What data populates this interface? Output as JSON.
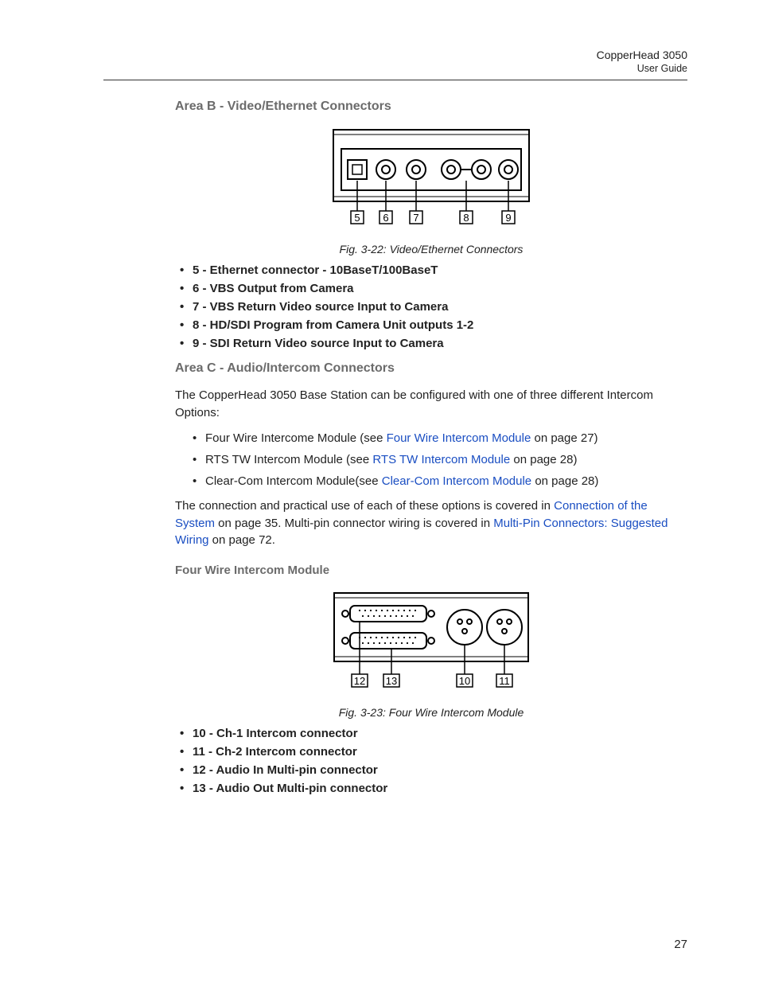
{
  "header": {
    "product": "CopperHead 3050",
    "doc": "User Guide"
  },
  "sectionB": {
    "heading": "Area B - Video/Ethernet Connectors",
    "fig_caption": "Fig. 3-22: Video/Ethernet Connectors",
    "labels": {
      "l5": "5",
      "l6": "6",
      "l7": "7",
      "l8": "8",
      "l9": "9"
    },
    "items": [
      "5 - Ethernet connector - 10BaseT/100BaseT",
      "6 - VBS Output from Camera",
      "7 - VBS Return Video source Input to Camera",
      "8 - HD/SDI Program from Camera Unit outputs 1-2",
      "9 - SDI Return Video source Input to Camera"
    ]
  },
  "sectionC": {
    "heading": "Area C - Audio/Intercom Connectors",
    "intro": "The CopperHead 3050 Base Station can be configured with one of three different Intercom Options:",
    "opts": [
      {
        "pre": "Four Wire Intercome Module (see ",
        "link": "Four Wire Intercom Module",
        "post": " on page 27)"
      },
      {
        "pre": "RTS TW Intercom Module (see ",
        "link": "RTS TW Intercom Module",
        "post": " on page 28)"
      },
      {
        "pre": "Clear-Com Intercom Module(see ",
        "link": "Clear-Com Intercom Module",
        "post": " on page 28)"
      }
    ],
    "para2": {
      "t1": "The connection and practical use of each of these options is covered in ",
      "link1": "Connection of the System",
      "t2": " on page 35. Multi-pin connector wiring is covered in ",
      "link2": "Multi-Pin Connectors: Suggested Wiring",
      "t3": " on page 72."
    }
  },
  "fourWire": {
    "heading": "Four Wire Intercom Module",
    "fig_caption": "Fig. 3-23: Four Wire Intercom Module",
    "labels": {
      "l10": "10",
      "l11": "11",
      "l12": "12",
      "l13": "13"
    },
    "items": [
      "10 - Ch-1 Intercom connector",
      "11 - Ch-2 Intercom connector",
      "12 - Audio In Multi-pin connector",
      "13 - Audio Out Multi-pin connector"
    ]
  },
  "page_number": "27"
}
